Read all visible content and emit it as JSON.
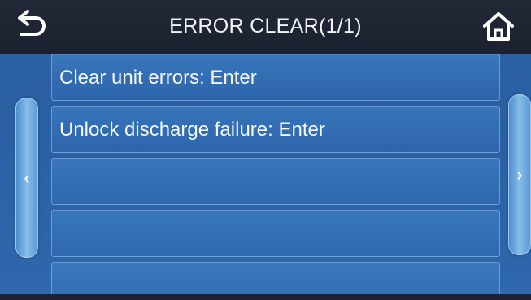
{
  "header": {
    "title": "ERROR CLEAR(1/1)",
    "back_icon": "back-arrow-icon",
    "home_icon": "home-icon"
  },
  "list": {
    "rows": [
      {
        "label": "Clear unit errors: Enter"
      },
      {
        "label": "Unlock discharge failure: Enter"
      },
      {
        "label": ""
      },
      {
        "label": ""
      },
      {
        "label": ""
      }
    ]
  },
  "nav": {
    "prev_glyph": "‹",
    "next_glyph": "›"
  },
  "colors": {
    "header_bg": "#1f2433",
    "screen_bg": "#2c63a6",
    "row_border": "#96c3f5",
    "tab_highlight": "#86bde8",
    "text": "#f4f7fb"
  }
}
